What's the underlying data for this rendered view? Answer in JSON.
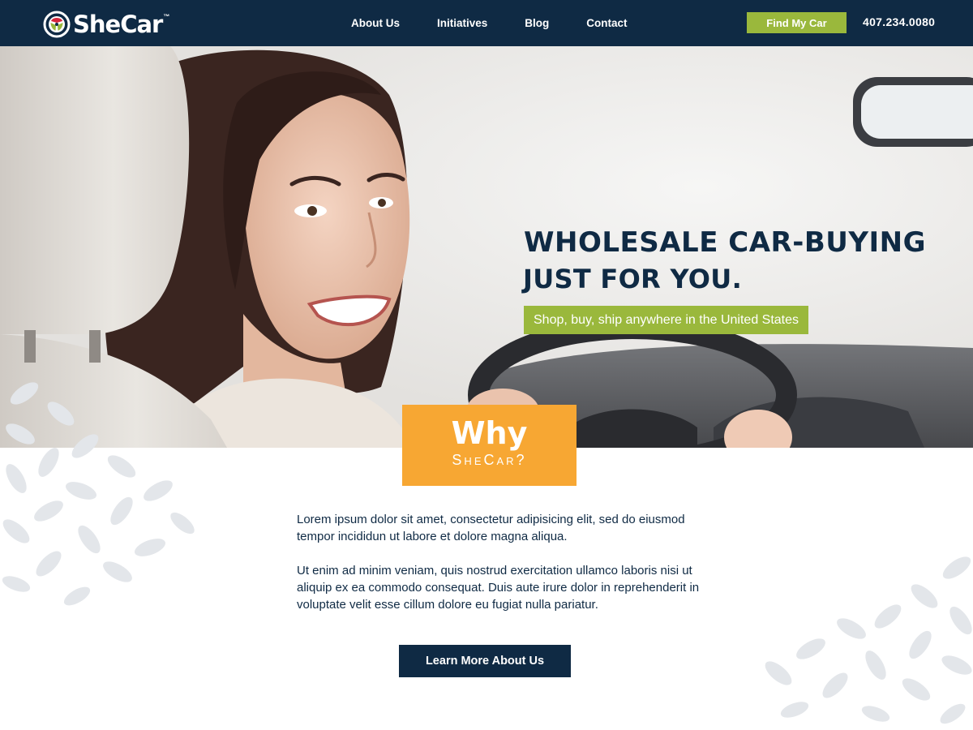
{
  "brand": {
    "name": "SheCar",
    "trademark": "™",
    "colors": {
      "navy": "#0f2a44",
      "green": "#9ab83c",
      "orange": "#f7a733",
      "pattern": "#e3e6ea"
    }
  },
  "nav": {
    "links": [
      {
        "label": "About Us"
      },
      {
        "label": "Initiatives"
      },
      {
        "label": "Blog"
      },
      {
        "label": "Contact"
      }
    ],
    "cta_label": "Find My Car",
    "phone": "407.234.0080"
  },
  "hero": {
    "headline_line1": "WHOLESALE CAR-BUYING",
    "headline_line2": "JUST FOR YOU.",
    "tagline": "Shop, buy, ship anywhere in the United States",
    "image": "smiling woman in driver seat looking back"
  },
  "why": {
    "title": "Why",
    "subtitle": "SheCar?"
  },
  "about": {
    "paragraphs": [
      "Lorem ipsum dolor sit amet, consectetur adipisicing elit, sed do eiusmod tempor incididun ut labore et dolore magna aliqua.",
      "Ut enim ad minim veniam, quis nostrud exercitation ullamco laboris nisi ut aliquip ex ea commodo consequat. Duis aute irure dolor in reprehenderit in voluptate velit esse cillum dolore eu fugiat nulla pariatur."
    ],
    "button_label": "Learn More About Us"
  },
  "icons": {
    "logo": "steering-wheel-icon",
    "pattern": "leaf-pattern"
  }
}
